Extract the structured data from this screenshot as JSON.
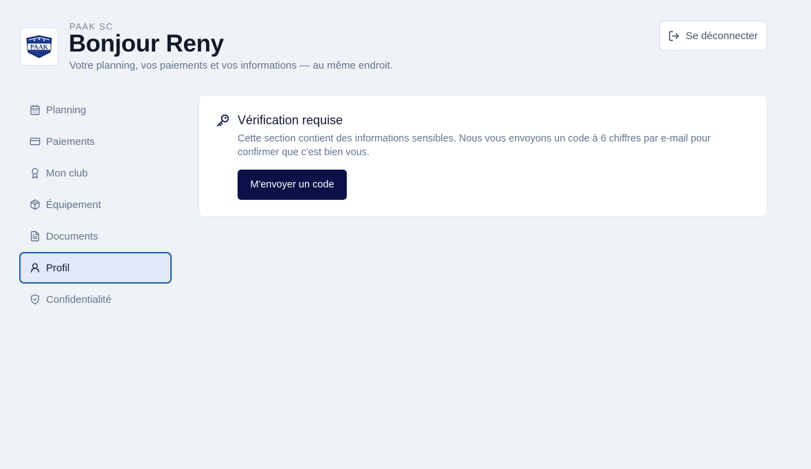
{
  "header": {
    "club_name": "PAAK SC",
    "greeting": "Bonjour Reny",
    "subtitle": "Votre planning, vos paiements et vos informations — au même endroit.",
    "logo_text": "PAAK",
    "logout_label": "Se déconnecter",
    "logout_icon": "logout-icon"
  },
  "sidebar": {
    "items": [
      {
        "label": "Planning",
        "icon": "calendar-icon",
        "active": false
      },
      {
        "label": "Paiements",
        "icon": "credit-card-icon",
        "active": false
      },
      {
        "label": "Mon club",
        "icon": "award-icon",
        "active": false
      },
      {
        "label": "Équipement",
        "icon": "package-icon",
        "active": false
      },
      {
        "label": "Documents",
        "icon": "document-icon",
        "active": false
      },
      {
        "label": "Profil",
        "icon": "user-icon",
        "active": true
      },
      {
        "label": "Confidentialité",
        "icon": "shield-icon",
        "active": false
      }
    ]
  },
  "verification": {
    "icon": "key-icon",
    "title": "Vérification requise",
    "description": "Cette section contient des informations sensibles. Nous vous envoyons un code à 6 chiffres par e-mail pour confirmer que c'est bien vous.",
    "button_label": "M'envoyer un code"
  },
  "colors": {
    "background": "#eff2f7",
    "primary_button": "#0a1148",
    "active_border": "#1d5fb0",
    "active_bg": "#e1e8f8"
  }
}
